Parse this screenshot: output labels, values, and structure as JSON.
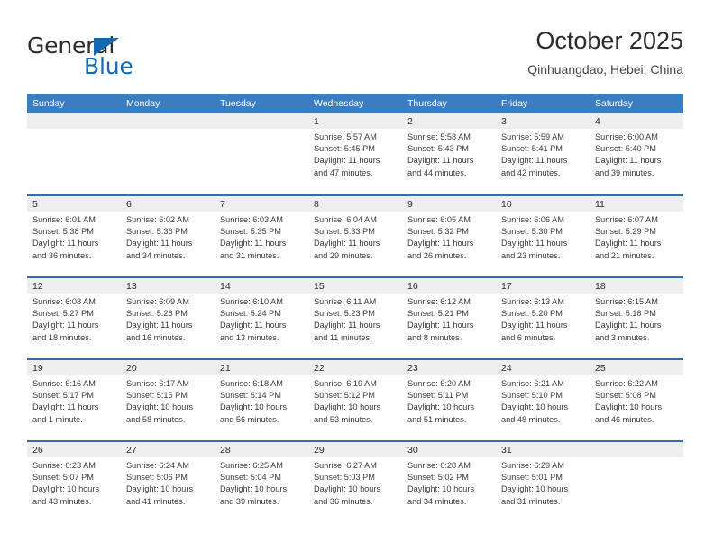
{
  "logo": {
    "word1": "General",
    "word2": "Blue",
    "triangle_color": "#1268b3",
    "icon": "general-blue-logo"
  },
  "header": {
    "title": "October 2025",
    "subtitle": "Qinhuangdao, Hebei, China"
  },
  "theme": {
    "header_blue": "#3b7dbf",
    "row_rule_blue": "#2f6fb0",
    "daynum_band": "#eeeeee",
    "text": "#3a3a3a"
  },
  "weekday_headers": [
    "Sunday",
    "Monday",
    "Tuesday",
    "Wednesday",
    "Thursday",
    "Friday",
    "Saturday"
  ],
  "weeks": [
    [
      {
        "empty": true
      },
      {
        "empty": true
      },
      {
        "empty": true
      },
      {
        "day": "1",
        "sunrise": "Sunrise: 5:57 AM",
        "sunset": "Sunset: 5:45 PM",
        "daylight1": "Daylight: 11 hours",
        "daylight2": "and 47 minutes."
      },
      {
        "day": "2",
        "sunrise": "Sunrise: 5:58 AM",
        "sunset": "Sunset: 5:43 PM",
        "daylight1": "Daylight: 11 hours",
        "daylight2": "and 44 minutes."
      },
      {
        "day": "3",
        "sunrise": "Sunrise: 5:59 AM",
        "sunset": "Sunset: 5:41 PM",
        "daylight1": "Daylight: 11 hours",
        "daylight2": "and 42 minutes."
      },
      {
        "day": "4",
        "sunrise": "Sunrise: 6:00 AM",
        "sunset": "Sunset: 5:40 PM",
        "daylight1": "Daylight: 11 hours",
        "daylight2": "and 39 minutes."
      }
    ],
    [
      {
        "day": "5",
        "sunrise": "Sunrise: 6:01 AM",
        "sunset": "Sunset: 5:38 PM",
        "daylight1": "Daylight: 11 hours",
        "daylight2": "and 36 minutes."
      },
      {
        "day": "6",
        "sunrise": "Sunrise: 6:02 AM",
        "sunset": "Sunset: 5:36 PM",
        "daylight1": "Daylight: 11 hours",
        "daylight2": "and 34 minutes."
      },
      {
        "day": "7",
        "sunrise": "Sunrise: 6:03 AM",
        "sunset": "Sunset: 5:35 PM",
        "daylight1": "Daylight: 11 hours",
        "daylight2": "and 31 minutes."
      },
      {
        "day": "8",
        "sunrise": "Sunrise: 6:04 AM",
        "sunset": "Sunset: 5:33 PM",
        "daylight1": "Daylight: 11 hours",
        "daylight2": "and 29 minutes."
      },
      {
        "day": "9",
        "sunrise": "Sunrise: 6:05 AM",
        "sunset": "Sunset: 5:32 PM",
        "daylight1": "Daylight: 11 hours",
        "daylight2": "and 26 minutes."
      },
      {
        "day": "10",
        "sunrise": "Sunrise: 6:06 AM",
        "sunset": "Sunset: 5:30 PM",
        "daylight1": "Daylight: 11 hours",
        "daylight2": "and 23 minutes."
      },
      {
        "day": "11",
        "sunrise": "Sunrise: 6:07 AM",
        "sunset": "Sunset: 5:29 PM",
        "daylight1": "Daylight: 11 hours",
        "daylight2": "and 21 minutes."
      }
    ],
    [
      {
        "day": "12",
        "sunrise": "Sunrise: 6:08 AM",
        "sunset": "Sunset: 5:27 PM",
        "daylight1": "Daylight: 11 hours",
        "daylight2": "and 18 minutes."
      },
      {
        "day": "13",
        "sunrise": "Sunrise: 6:09 AM",
        "sunset": "Sunset: 5:26 PM",
        "daylight1": "Daylight: 11 hours",
        "daylight2": "and 16 minutes."
      },
      {
        "day": "14",
        "sunrise": "Sunrise: 6:10 AM",
        "sunset": "Sunset: 5:24 PM",
        "daylight1": "Daylight: 11 hours",
        "daylight2": "and 13 minutes."
      },
      {
        "day": "15",
        "sunrise": "Sunrise: 6:11 AM",
        "sunset": "Sunset: 5:23 PM",
        "daylight1": "Daylight: 11 hours",
        "daylight2": "and 11 minutes."
      },
      {
        "day": "16",
        "sunrise": "Sunrise: 6:12 AM",
        "sunset": "Sunset: 5:21 PM",
        "daylight1": "Daylight: 11 hours",
        "daylight2": "and 8 minutes."
      },
      {
        "day": "17",
        "sunrise": "Sunrise: 6:13 AM",
        "sunset": "Sunset: 5:20 PM",
        "daylight1": "Daylight: 11 hours",
        "daylight2": "and 6 minutes."
      },
      {
        "day": "18",
        "sunrise": "Sunrise: 6:15 AM",
        "sunset": "Sunset: 5:18 PM",
        "daylight1": "Daylight: 11 hours",
        "daylight2": "and 3 minutes."
      }
    ],
    [
      {
        "day": "19",
        "sunrise": "Sunrise: 6:16 AM",
        "sunset": "Sunset: 5:17 PM",
        "daylight1": "Daylight: 11 hours",
        "daylight2": "and 1 minute."
      },
      {
        "day": "20",
        "sunrise": "Sunrise: 6:17 AM",
        "sunset": "Sunset: 5:15 PM",
        "daylight1": "Daylight: 10 hours",
        "daylight2": "and 58 minutes."
      },
      {
        "day": "21",
        "sunrise": "Sunrise: 6:18 AM",
        "sunset": "Sunset: 5:14 PM",
        "daylight1": "Daylight: 10 hours",
        "daylight2": "and 56 minutes."
      },
      {
        "day": "22",
        "sunrise": "Sunrise: 6:19 AM",
        "sunset": "Sunset: 5:12 PM",
        "daylight1": "Daylight: 10 hours",
        "daylight2": "and 53 minutes."
      },
      {
        "day": "23",
        "sunrise": "Sunrise: 6:20 AM",
        "sunset": "Sunset: 5:11 PM",
        "daylight1": "Daylight: 10 hours",
        "daylight2": "and 51 minutes."
      },
      {
        "day": "24",
        "sunrise": "Sunrise: 6:21 AM",
        "sunset": "Sunset: 5:10 PM",
        "daylight1": "Daylight: 10 hours",
        "daylight2": "and 48 minutes."
      },
      {
        "day": "25",
        "sunrise": "Sunrise: 6:22 AM",
        "sunset": "Sunset: 5:08 PM",
        "daylight1": "Daylight: 10 hours",
        "daylight2": "and 46 minutes."
      }
    ],
    [
      {
        "day": "26",
        "sunrise": "Sunrise: 6:23 AM",
        "sunset": "Sunset: 5:07 PM",
        "daylight1": "Daylight: 10 hours",
        "daylight2": "and 43 minutes."
      },
      {
        "day": "27",
        "sunrise": "Sunrise: 6:24 AM",
        "sunset": "Sunset: 5:06 PM",
        "daylight1": "Daylight: 10 hours",
        "daylight2": "and 41 minutes."
      },
      {
        "day": "28",
        "sunrise": "Sunrise: 6:25 AM",
        "sunset": "Sunset: 5:04 PM",
        "daylight1": "Daylight: 10 hours",
        "daylight2": "and 39 minutes."
      },
      {
        "day": "29",
        "sunrise": "Sunrise: 6:27 AM",
        "sunset": "Sunset: 5:03 PM",
        "daylight1": "Daylight: 10 hours",
        "daylight2": "and 36 minutes."
      },
      {
        "day": "30",
        "sunrise": "Sunrise: 6:28 AM",
        "sunset": "Sunset: 5:02 PM",
        "daylight1": "Daylight: 10 hours",
        "daylight2": "and 34 minutes."
      },
      {
        "day": "31",
        "sunrise": "Sunrise: 6:29 AM",
        "sunset": "Sunset: 5:01 PM",
        "daylight1": "Daylight: 10 hours",
        "daylight2": "and 31 minutes."
      },
      {
        "empty": true
      }
    ]
  ]
}
